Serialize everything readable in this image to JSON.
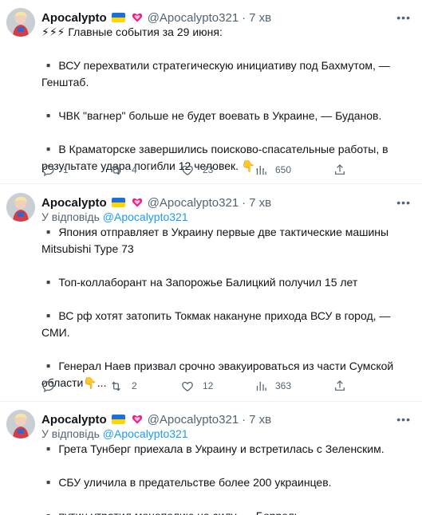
{
  "tweets": [
    {
      "name": "Apocalypto",
      "handle": "@Apocalypto321",
      "sep": "·",
      "time": "7 хв",
      "reply_prefix": "",
      "reply_handle": "",
      "lines": [
        "⚡⚡⚡ Главные события за 29 июня:",
        "",
        "▪️ ВСУ перехватили стратегическую инициативу под Бахмутом, —",
        "Генштаб.",
        "",
        "▪️ ЧВК \"вагнер\" больше не будет воевать в Украине, — Буданов.",
        "",
        "▪️ В Краматорске завершились поисково-спасательные работы, в",
        "результате удара погибли 12 человек. 👇..."
      ],
      "replies": "1",
      "retweets": "4",
      "likes": "23",
      "views": "650"
    },
    {
      "name": "Apocalypto",
      "handle": "@Apocalypto321",
      "sep": "·",
      "time": "7 хв",
      "reply_prefix": "У відповідь ",
      "reply_handle": "@Apocalypto321",
      "lines": [
        "▪️ Япония отправляет в Украину первые две тактические машины",
        "Mitsubishi Type 73",
        "",
        "▪️ Топ-коллаборант на Запорожье Балицкий получил 15 лет",
        "",
        "▪️ ВС рф хотят затопить Токмак накануне прихода ВСУ в город, —",
        "СМИ.",
        "",
        "▪️ Генерал Наев призвал срочно эвакуироваться из части Сумской",
        "области👇..."
      ],
      "replies": "",
      "retweets": "2",
      "likes": "12",
      "views": "363"
    },
    {
      "name": "Apocalypto",
      "handle": "@Apocalypto321",
      "sep": "·",
      "time": "7 хв",
      "reply_prefix": "У відповідь ",
      "reply_handle": "@Apocalypto321",
      "lines": [
        "▪️ Грета Тунберг приехала в Украину и встретилась с Зеленским.",
        "",
        "▪️ СБУ уличила в предательстве более 200 украинцев.",
        "",
        "▪️ путин утратил монополию на силу, — Боррель."
      ]
    }
  ],
  "colors": {
    "accent": "#1d9bf0",
    "muted": "#536471",
    "text": "#0f1419",
    "flag_blue": "#1d6fd6",
    "flag_yellow": "#ffd600",
    "heart": "#f91880"
  },
  "icons": {
    "reply": "reply-icon",
    "retweet": "retweet-icon",
    "like": "like-icon",
    "views": "views-icon",
    "share": "share-icon",
    "more": "more-icon"
  }
}
